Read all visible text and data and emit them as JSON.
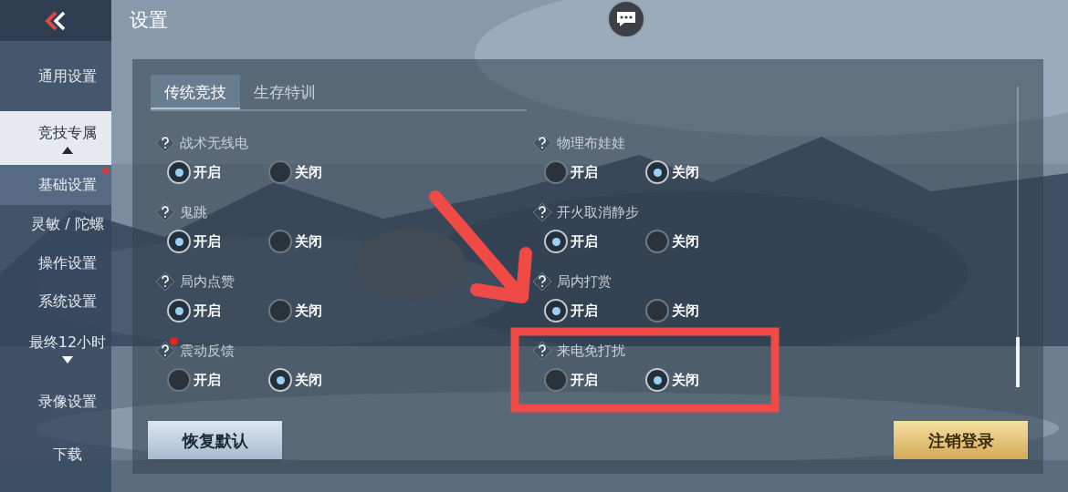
{
  "header": {
    "title": "设置"
  },
  "sidebar": {
    "items": [
      {
        "label": "通用设置",
        "kind": "item",
        "selected": false,
        "badge": false
      },
      {
        "label": "竞技专属",
        "kind": "group",
        "selected": true,
        "badge": false,
        "expanded": true,
        "children": [
          {
            "label": "基础设置",
            "selected": true,
            "badge": true
          }
        ]
      },
      {
        "label": "灵敏 / 陀螺",
        "kind": "item",
        "selected": false,
        "badge": false
      },
      {
        "label": "操作设置",
        "kind": "item",
        "selected": false,
        "badge": false
      },
      {
        "label": "系统设置",
        "kind": "item",
        "selected": false,
        "badge": false
      },
      {
        "label": "最终12小时",
        "kind": "group",
        "selected": false,
        "badge": false,
        "expanded": false
      },
      {
        "label": "录像设置",
        "kind": "item",
        "selected": false,
        "badge": false
      },
      {
        "label": "下载",
        "kind": "item",
        "selected": false,
        "badge": false
      }
    ]
  },
  "tabs": [
    {
      "label": "传统竞技",
      "selected": true
    },
    {
      "label": "生存特训",
      "selected": false
    }
  ],
  "settings": [
    {
      "label": "战术无线电",
      "badge": false,
      "options": [
        {
          "label": "开启",
          "selected": true
        },
        {
          "label": "关闭",
          "selected": false
        }
      ]
    },
    {
      "label": "鬼跳",
      "badge": false,
      "options": [
        {
          "label": "开启",
          "selected": true
        },
        {
          "label": "关闭",
          "selected": false
        }
      ]
    },
    {
      "label": "局内点赞",
      "badge": false,
      "options": [
        {
          "label": "开启",
          "selected": true
        },
        {
          "label": "关闭",
          "selected": false
        }
      ]
    },
    {
      "label": "震动反馈",
      "badge": true,
      "options": [
        {
          "label": "开启",
          "selected": false
        },
        {
          "label": "关闭",
          "selected": true
        }
      ]
    },
    {
      "label": "物理布娃娃",
      "badge": false,
      "options": [
        {
          "label": "开启",
          "selected": false
        },
        {
          "label": "关闭",
          "selected": true
        }
      ]
    },
    {
      "label": "开火取消静步",
      "badge": false,
      "options": [
        {
          "label": "开启",
          "selected": true
        },
        {
          "label": "关闭",
          "selected": false
        }
      ]
    },
    {
      "label": "局内打赏",
      "badge": false,
      "options": [
        {
          "label": "开启",
          "selected": true
        },
        {
          "label": "关闭",
          "selected": false
        }
      ]
    },
    {
      "label": "来电免打扰",
      "badge": false,
      "options": [
        {
          "label": "开启",
          "selected": false
        },
        {
          "label": "关闭",
          "selected": true
        }
      ]
    }
  ],
  "buttons": [
    {
      "label": "恢复默认",
      "kind": "secondary"
    },
    {
      "label": "注销登录",
      "kind": "primary"
    }
  ]
}
